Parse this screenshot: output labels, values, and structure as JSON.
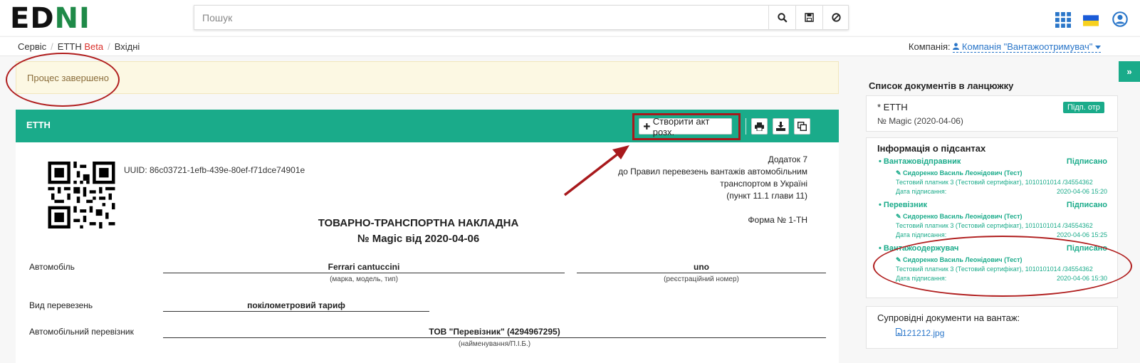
{
  "header": {
    "logo_part1": "ED",
    "logo_part2": "N",
    "logo_part3": "I",
    "search_placeholder": "Пошук",
    "icons": [
      "search-icon",
      "save-icon",
      "clear-icon",
      "apps-grid-icon",
      "ukraine-flag-icon",
      "user-account-icon"
    ]
  },
  "breadcrumb": {
    "items": [
      "Сервіс",
      "ЕТТН",
      "Вхідні"
    ],
    "beta": "Beta"
  },
  "company": {
    "label": "Компанія:",
    "name": "Компанія \"Вантажоотримувач\""
  },
  "alert": {
    "text": "Процес завершено"
  },
  "panel": {
    "title": "ЕТТН",
    "create_button": "Створити акт розх.",
    "tool_icons": [
      "print-icon",
      "download-icon",
      "copy-icon"
    ]
  },
  "document": {
    "uuid": "UUID: 86c03721-1efb-439e-80ef-f71dce74901e",
    "appendix": [
      "Додаток 7",
      "до Правил перевезень вантажів автомобільним",
      "транспортом в Україні",
      "(пункт 11.1 глави 11)"
    ],
    "title_line1": "ТОВАРНО-ТРАНСПОРТНА НАКЛАДНА",
    "title_line2": "№ Magic від 2020-04-06",
    "form_number": "Форма № 1-ТН",
    "fields": {
      "car_label": "Автомобіль",
      "car_model": "Ferrari cantuccini",
      "car_model_note": "(марка, модель, тип)",
      "car_reg": "uno",
      "car_reg_note": "(реєстраційний номер)",
      "transport_type_label": "Вид перевезень",
      "transport_type": "покілометровий тариф",
      "carrier_label": "Автомобільний перевізник",
      "carrier": "ТОВ \"Перевізник\" (4294967295)",
      "carrier_note": "(найменування/П.І.Б.)"
    }
  },
  "sidebar": {
    "chain_title": "Список документів в ланцюжку",
    "chain_doc": {
      "name": "* ЕТТН",
      "badge": "Підп. отр",
      "number": "№ Magic (2020-04-06)"
    },
    "signers_title": "Інформація о підсантах",
    "signers": [
      {
        "role": "Вантажовідправник",
        "status": "Підписано",
        "person": "Сидоренко Василь Леонідович (Тест)",
        "cert": "Тестовий платник 3 (Тестовий сертифікат), 1010101014 /34554362",
        "date_label": "Дата підписання:",
        "date": "2020-04-06 15:20"
      },
      {
        "role": "Перевізник",
        "status": "Підписано",
        "person": "Сидоренко Василь Леонідович (Тест)",
        "cert": "Тестовий платник 3 (Тестовий сертифікат), 1010101014 /34554362",
        "date_label": "Дата підписання:",
        "date": "2020-04-06 15:25"
      },
      {
        "role": "Вантажоодержувач",
        "status": "Підписано",
        "person": "Сидоренко Василь Леонідович (Тест)",
        "cert": "Тестовий платник 3 (Тестовий сертифікат), 1010101014 /34554362",
        "date_label": "Дата підписання:",
        "date": "2020-04-06 15:30"
      }
    ],
    "attachments_title": "Супровідні документи на вантаж:",
    "attachment_file": "121212.jpg"
  }
}
